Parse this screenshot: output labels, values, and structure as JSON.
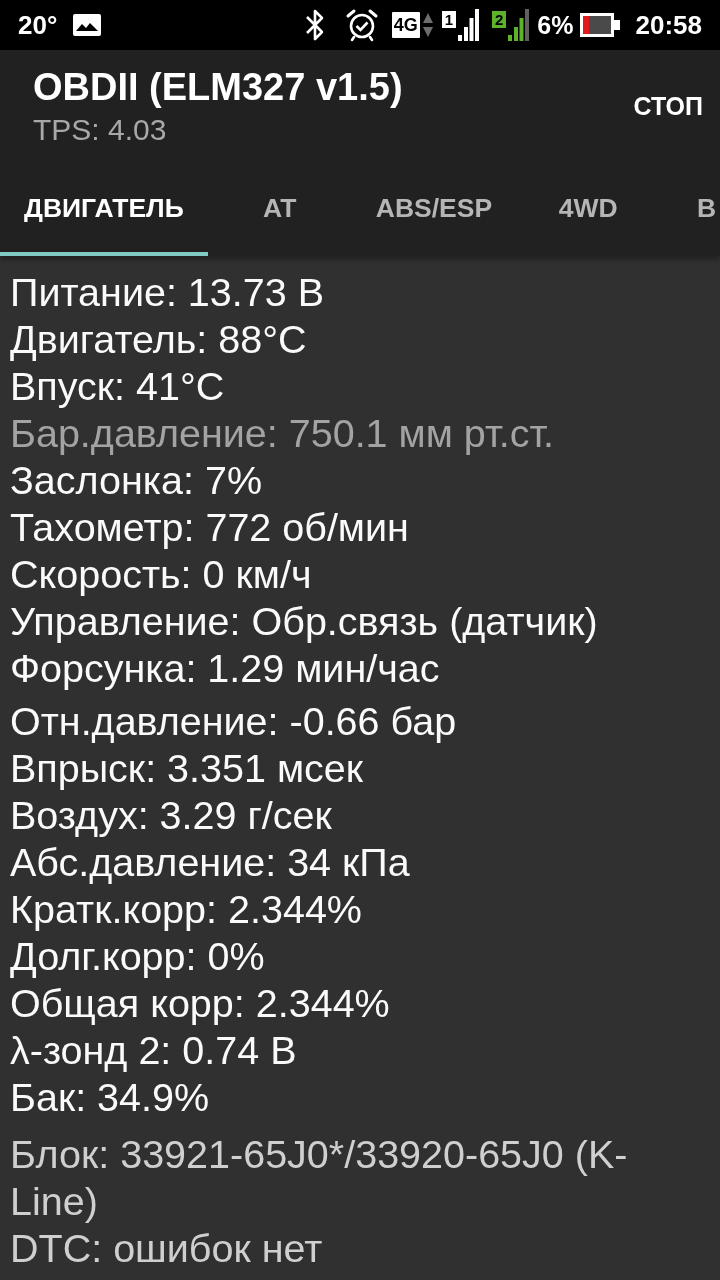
{
  "status_bar": {
    "temperature": "20°",
    "network_type": "4G",
    "sims": [
      {
        "number": "1",
        "color": "#ffffff"
      },
      {
        "number": "2",
        "color": "#5cb32a"
      }
    ],
    "battery_percent": "6%",
    "time": "20:58"
  },
  "app_bar": {
    "title": "OBDII (ELM327 v1.5)",
    "subtitle": "TPS: 4.03",
    "action": "СТОП"
  },
  "tabs": [
    {
      "label": "ДВИГАТЕЛЬ",
      "selected": true
    },
    {
      "label": "AT",
      "selected": false
    },
    {
      "label": "ABS/ESP",
      "selected": false
    },
    {
      "label": "4WD",
      "selected": false
    },
    {
      "label": "В",
      "selected": false
    }
  ],
  "sections": [
    {
      "kind": "readings",
      "lines": [
        {
          "text": "Питание: 13.73 В",
          "dimmed": false
        },
        {
          "text": "Двигатель: 88°C",
          "dimmed": false
        },
        {
          "text": "Впуск: 41°C",
          "dimmed": false
        },
        {
          "text": "Бар.давление: 750.1 мм рт.ст.",
          "dimmed": true
        },
        {
          "text": "Заслонка: 7%",
          "dimmed": false
        },
        {
          "text": "Тахометр: 772 об/мин",
          "dimmed": false
        },
        {
          "text": "Скорость: 0 км/ч",
          "dimmed": false
        },
        {
          "text": "Управление: Обр.связь (датчик)",
          "dimmed": false
        },
        {
          "text": "Форсунка: 1.29 мин/час",
          "dimmed": false
        }
      ]
    },
    {
      "kind": "readings",
      "lines": [
        {
          "text": "Отн.давление: -0.66 бар",
          "dimmed": false
        },
        {
          "text": "Впрыск: 3.351 мсек",
          "dimmed": false
        },
        {
          "text": "Воздух: 3.29 г/сек",
          "dimmed": false
        },
        {
          "text": "Абс.давление: 34 кПа",
          "dimmed": false
        },
        {
          "text": "Кратк.корр: 2.344%",
          "dimmed": false
        },
        {
          "text": "Долг.корр: 0%",
          "dimmed": false
        },
        {
          "text": "Общая корр: 2.344%",
          "dimmed": false
        },
        {
          "text": "λ-зонд 2: 0.74 В",
          "dimmed": false
        },
        {
          "text": "Бак: 34.9%",
          "dimmed": false
        }
      ]
    },
    {
      "kind": "info",
      "lines": [
        {
          "text": "Блок: 33921-65J0*/33920-65J0 (K-Line)",
          "dimmed": false
        },
        {
          "text": "DTC: ошибок нет",
          "dimmed": false
        }
      ]
    }
  ]
}
